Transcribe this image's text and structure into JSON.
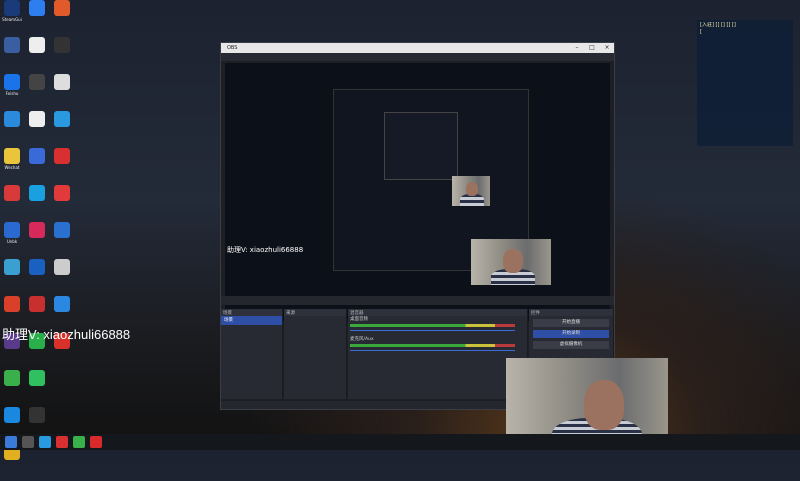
{
  "desktop": {
    "watermark_text": "助理V: xiaozhuli66888",
    "icons_col1": [
      "SteamGui",
      "",
      "Feishu",
      "",
      "Wechat",
      "",
      "Unbk",
      "",
      "",
      "",
      "",
      "",
      ""
    ],
    "icons_col2": [
      "",
      "",
      "",
      "",
      "",
      "",
      "",
      "",
      "",
      "",
      "",
      "",
      ""
    ]
  },
  "chat_overlay": {
    "lines": [
      "[入驻] [] [] [] []",
      "[",
      "",
      "",
      "",
      "",
      "",
      "",
      "",
      "",
      "",
      "",
      "",
      "",
      "",
      "",
      ""
    ]
  },
  "obs": {
    "title": "OBS",
    "menu": [
      "",
      "",
      "",
      "",
      "",
      "",
      ""
    ],
    "name_tag": "助理V: xiaozhuli66888",
    "dock_tabs": [
      "",
      "",
      ""
    ],
    "scenes_header": "场景",
    "scenes": [
      "场景"
    ],
    "sources_header": "来源",
    "sources": [
      "",
      "",
      "",
      "",
      "",
      "",
      "",
      ""
    ],
    "mixer_header": "混音器",
    "mixer_channels": [
      "桌面音频",
      "麦克风/Aux"
    ],
    "controls_header": "控件",
    "controls": [
      "开始直播",
      "开始录制",
      "虚拟摄像机"
    ],
    "status": ""
  },
  "taskbar": {
    "time": "",
    "date": ""
  },
  "colors": {
    "accent": "#2f4ea5",
    "chat_text": "#f3e9a4",
    "obs_bg": "#1e1f24"
  }
}
